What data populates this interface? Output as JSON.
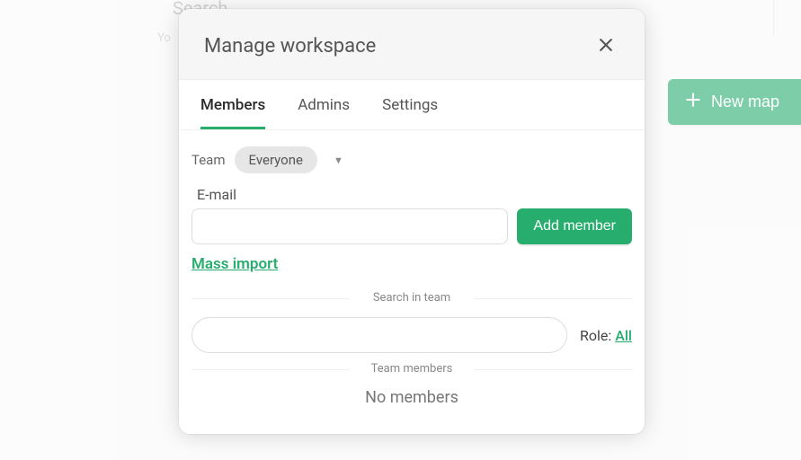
{
  "background": {
    "search_label": "Search",
    "hint_prefix": "Yo",
    "new_map_label": "New map"
  },
  "modal": {
    "title": "Manage workspace",
    "tabs": {
      "members": "Members",
      "admins": "Admins",
      "settings": "Settings"
    },
    "team": {
      "label": "Team",
      "selected": "Everyone"
    },
    "email": {
      "label": "E-mail",
      "value": ""
    },
    "add_member_label": "Add member",
    "mass_import_label": "Mass import",
    "search_in_team_label": "Search in team",
    "search_value": "",
    "role": {
      "label": "Role: ",
      "value": "All"
    },
    "team_members_label": "Team members",
    "no_members_label": "No members"
  },
  "colors": {
    "accent": "#27ae6f"
  }
}
